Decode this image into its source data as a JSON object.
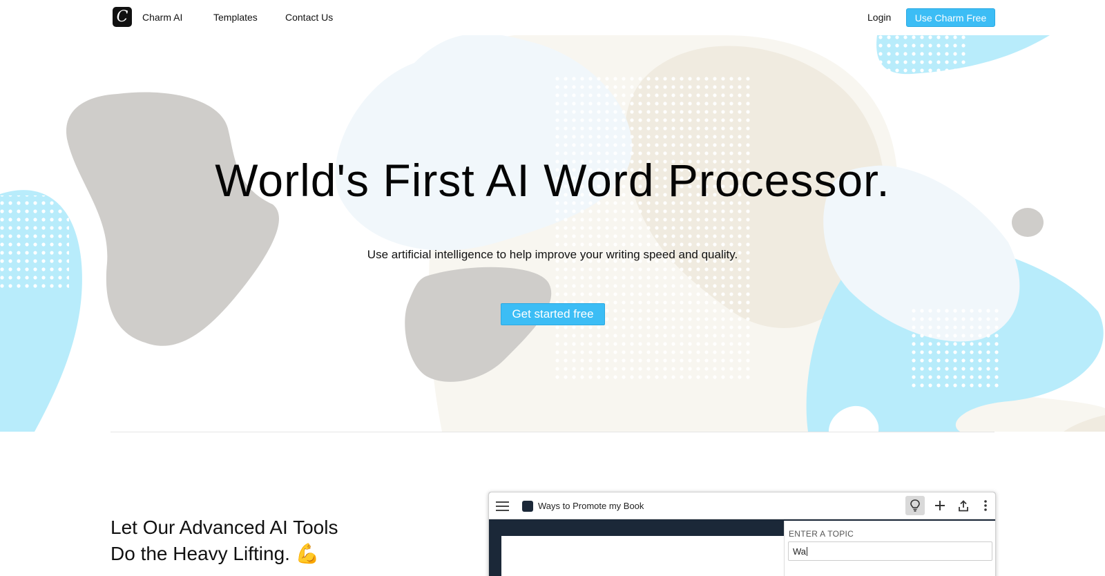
{
  "nav": {
    "brand": "Charm AI",
    "links": [
      "Templates",
      "Contact Us"
    ],
    "login": "Login",
    "cta": "Use Charm Free"
  },
  "hero": {
    "title": "World's First AI Word Processor.",
    "subtitle": "Use artificial intelligence to help improve your writing speed and quality.",
    "cta": "Get started free"
  },
  "feature": {
    "title_line1": "Let Our Advanced AI Tools",
    "title_line2": "Do the Heavy Lifting.",
    "emoji": "💪"
  },
  "app_preview": {
    "doc_title": "Ways to Promote my Book",
    "panel_label": "ENTER A TOPIC",
    "input_value": "Wa"
  },
  "colors": {
    "accent": "#3cbdf5",
    "blob_blue": "#b8ecfb",
    "blob_gray": "#cfcdca",
    "blob_beige": "#f0ebe0",
    "blob_pale_blue": "#f1f7fb"
  },
  "icons": [
    "charm-logo-icon",
    "hamburger-icon",
    "document-icon",
    "lightbulb-icon",
    "plus-icon",
    "share-icon",
    "more-icon"
  ]
}
